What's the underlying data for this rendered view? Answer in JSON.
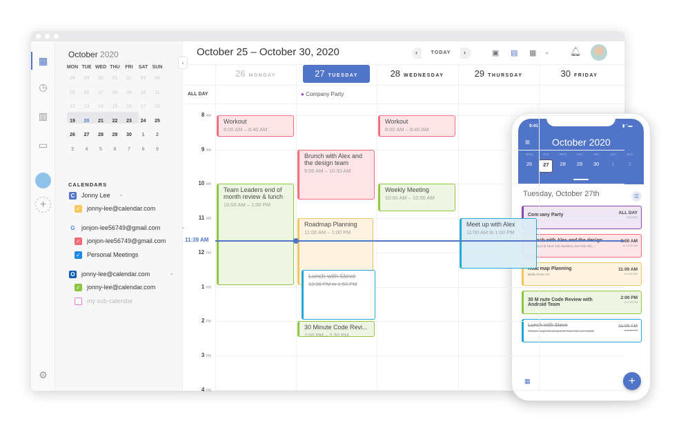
{
  "sidebar": {
    "month": "October",
    "year": "2020",
    "weekdays": [
      "MON",
      "TUE",
      "WED",
      "THU",
      "FRI",
      "SAT",
      "SUN"
    ],
    "weeks": [
      [
        "28",
        "29",
        "30",
        "01",
        "02",
        "03",
        "04"
      ],
      [
        "05",
        "06",
        "07",
        "08",
        "09",
        "10",
        "11"
      ],
      [
        "12",
        "13",
        "14",
        "15",
        "16",
        "17",
        "18"
      ],
      [
        "19",
        "20",
        "21",
        "22",
        "23",
        "24",
        "25"
      ],
      [
        "26",
        "27",
        "28",
        "29",
        "30",
        "1",
        "2"
      ],
      [
        "3",
        "4",
        "5",
        "6",
        "7",
        "8",
        "9"
      ]
    ],
    "calendars_title": "CALENDARS",
    "calendars": [
      {
        "account": "Jonny Lee",
        "icon": "calendar-app-icon",
        "items": [
          {
            "label": "jonny-lee@calendar.com",
            "color": "#f9c85c",
            "checked": true
          }
        ]
      },
      {
        "account": "jonjon-lee56749@gmail.com",
        "icon": "google-icon",
        "items": [
          {
            "label": "jonjon-lee56749@gmail.com",
            "color": "#f06a7a",
            "checked": true
          },
          {
            "label": "Personal Meetings",
            "color": "#1e88e5",
            "checked": true
          }
        ]
      },
      {
        "account": "jonny-lee@calendar.com",
        "icon": "outlook-icon",
        "items": [
          {
            "label": "jonny-lee@calendar.com",
            "color": "#8cc63f",
            "checked": true
          },
          {
            "label": "my sub-calendar",
            "color": "#e879d6",
            "checked": false
          }
        ]
      }
    ]
  },
  "header": {
    "title": "October 25 – October 30,  2020",
    "today_label": "TODAY"
  },
  "days": [
    {
      "num": "26",
      "name": "MONDAY"
    },
    {
      "num": "27",
      "name": "TUESDAY"
    },
    {
      "num": "28",
      "name": "WEDNESDAY"
    },
    {
      "num": "29",
      "name": "THURSDAY"
    },
    {
      "num": "30",
      "name": "FRIDAY"
    }
  ],
  "allday": {
    "label": "ALL DAY",
    "event": "Company Party",
    "color": "#8e44ad"
  },
  "hours": [
    {
      "h": "8",
      "ap": "AM"
    },
    {
      "h": "9",
      "ap": "AM"
    },
    {
      "h": "10",
      "ap": "AM"
    },
    {
      "h": "11",
      "ap": "AM"
    },
    {
      "h": "12",
      "ap": "PM"
    },
    {
      "h": "1",
      "ap": "PM"
    },
    {
      "h": "2",
      "ap": "PM"
    },
    {
      "h": "3",
      "ap": "PM"
    },
    {
      "h": "4",
      "ap": "PM"
    }
  ],
  "now": {
    "label": "11:39 AM",
    "time": 11.65
  },
  "events": [
    {
      "day": 0,
      "start": 8,
      "end": 8.67,
      "title": "Workout",
      "time": "8:00 AM – 8:40 AM",
      "border": "#f06a7a",
      "fill": "#fde4e7"
    },
    {
      "day": 2,
      "start": 8,
      "end": 8.67,
      "title": "Workout",
      "time": "8:00 AM – 8:40 AM",
      "border": "#f06a7a",
      "fill": "#fde4e7"
    },
    {
      "day": 1,
      "start": 9,
      "end": 10.5,
      "title": "Brunch with Alex and the design team",
      "time": "9:00 AM – 10:30 AM",
      "border": "#f06a7a",
      "fill": "#fde4e7"
    },
    {
      "day": 0,
      "start": 10,
      "end": 13,
      "title": "Team Leaders end of month review & lunch",
      "time": "10:00 AM – 1:00 PM",
      "border": "#8cc63f",
      "fill": "#eef6e3"
    },
    {
      "day": 2,
      "start": 10,
      "end": 10.83,
      "title": "Weekly Meeting",
      "time": "10:00 AM – 10:50 AM",
      "border": "#8cc63f",
      "fill": "#eef6e3"
    },
    {
      "day": 1,
      "start": 11,
      "end": 13,
      "title": "Roadmap Planning",
      "time": "11:00 AM – 1:00 PM",
      "border": "#f5c45e",
      "fill": "#fdf3df"
    },
    {
      "day": 3,
      "start": 11,
      "end": 12.5,
      "title": "Meet up with Alex",
      "time": "11:00 AM to 1:00 PM",
      "border": "#1aa6d6",
      "fill": "#dcedf5"
    },
    {
      "day": 1,
      "start": 12.5,
      "end": 14,
      "title": "Lunch with Steve",
      "time": "12:30 PM to 1:50 PM",
      "border": "#1aa6d6",
      "fill": "#ffffff",
      "struck": true,
      "indent": true
    },
    {
      "day": 1,
      "start": 14,
      "end": 14.5,
      "title": "30 Minute Code Revi...",
      "time": "2:00 PM – 2:30 PM",
      "border": "#8cc63f",
      "fill": "#eef6e3"
    }
  ],
  "phone": {
    "clock": "9:41",
    "month": "October 2020",
    "weekdays": [
      "MON",
      "TUE",
      "WED",
      "THU",
      "FRI",
      "SAT",
      "SUN"
    ],
    "dates": [
      "26",
      "27",
      "28",
      "29",
      "30",
      "1",
      "2"
    ],
    "date_title": "Tuesday, October 27th",
    "events": [
      {
        "title": "Company Party",
        "sub": "",
        "time": "ALL DAY",
        "end": "10/29/20",
        "border": "#8e44ad",
        "fill": "#efe6f5"
      },
      {
        "title": "Brunch with Alex and the design...",
        "sub": "Teaquation & Tonic 115 Hamilton Ave Palo Alto...",
        "time": "9:00 AM",
        "end": "to 10:30 AM",
        "border": "#f06a7a",
        "fill": "#fde4e7"
      },
      {
        "title": "Roadmap Planning",
        "sub": "Berlin Room #3",
        "time": "11:00 AM",
        "end": "to 1:00 PM",
        "border": "#f5c45e",
        "fill": "#fdf3df"
      },
      {
        "title": "30 Minute Code Review with Android Team",
        "sub": "",
        "time": "2:00 PM",
        "end": "to 2:30 PM",
        "border": "#8cc63f",
        "fill": "#eef6e3"
      },
      {
        "title": "Lunch with Steve",
        "sub": "Ramon Nagi 541 Bryant St, Palo Alto, CA 94301",
        "time": "11:00 AM",
        "end": "to 1:00 PM",
        "border": "#1aa6d6",
        "fill": "#ffffff",
        "struck": true
      }
    ]
  },
  "colors": {
    "accent": "#4f74c8"
  }
}
